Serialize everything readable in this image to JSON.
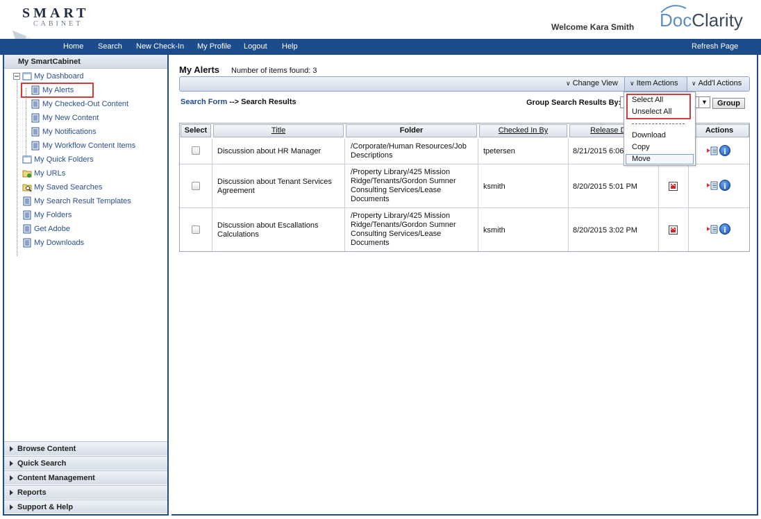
{
  "header": {
    "logo_top": "SMART",
    "logo_bottom": "CABINET",
    "welcome": "Welcome Kara Smith",
    "brand_doc": "Doc",
    "brand_clarity": "Clarity"
  },
  "nav": {
    "items": [
      "Home",
      "Search",
      "New Check-In",
      "My Profile",
      "Logout",
      "Help"
    ],
    "refresh": "Refresh Page"
  },
  "sidebar": {
    "title": "My SmartCabinet",
    "tree": [
      {
        "label": "My Dashboard",
        "icon": "folder-open-icon"
      },
      {
        "label": "My Alerts",
        "icon": "document-icon",
        "selected": true
      },
      {
        "label": "My Checked-Out Content",
        "icon": "document-icon"
      },
      {
        "label": "My New Content",
        "icon": "document-icon"
      },
      {
        "label": "My Notifications",
        "icon": "document-icon"
      },
      {
        "label": "My Workflow Content Items",
        "icon": "document-icon"
      },
      {
        "label": "My Quick Folders",
        "icon": "folder-open-icon"
      },
      {
        "label": "My URLs",
        "icon": "folder-link-icon"
      },
      {
        "label": "My Saved Searches",
        "icon": "folder-search-icon"
      },
      {
        "label": "My Search Result Templates",
        "icon": "document-icon"
      },
      {
        "label": "My Folders",
        "icon": "document-icon"
      },
      {
        "label": "Get Adobe",
        "icon": "document-icon"
      },
      {
        "label": "My Downloads",
        "icon": "document-icon"
      }
    ],
    "accordion": [
      "Browse Content",
      "Quick Search",
      "Content Management",
      "Reports",
      "Support & Help"
    ]
  },
  "main": {
    "title": "My Alerts",
    "items_found": "Number of items found: 3",
    "toolbar": {
      "change_view": "Change View",
      "item_actions": "Item Actions",
      "addl_actions": "Add'l Actions"
    },
    "breadcrumb_link": "Search Form",
    "breadcrumb_rest": " --> Search Results",
    "group_label": "Group Search Results By:",
    "group_button": "Group",
    "dropdown": {
      "select_all": "Select All",
      "unselect_all": "Unselect All",
      "separator": "------------------------",
      "download": "Download",
      "copy": "Copy",
      "move": "Move"
    },
    "table": {
      "headers": [
        "Select",
        "Title",
        "Folder",
        "Checked In By",
        "Release Date",
        "",
        "Actions"
      ],
      "rows": [
        {
          "title": "Discussion about HR Manager",
          "folder": "/Corporate/Human Resources/Job Descriptions",
          "checked_in_by": "tpetersen",
          "release_date": "8/21/2015 6:06",
          "has_flag": false
        },
        {
          "title": "Discussion about Tenant Services Agreement",
          "folder": "/Property Library/425 Mission Ridge/Tenants/Gordon Sumner Consulting Services/Lease Documents",
          "checked_in_by": "ksmith",
          "release_date": "8/20/2015 5:01 PM",
          "has_flag": true
        },
        {
          "title": "Discussion about Escallations Calculations",
          "folder": "/Property Library/425 Mission Ridge/Tenants/Gordon Sumner Consulting Services/Lease Documents",
          "checked_in_by": "ksmith",
          "release_date": "8/20/2015 3:02 PM",
          "has_flag": true
        }
      ]
    }
  },
  "colors": {
    "nav_blue": "#1d4c8c",
    "link_blue": "#2a4f8f",
    "highlight_red": "#d33b3b"
  }
}
